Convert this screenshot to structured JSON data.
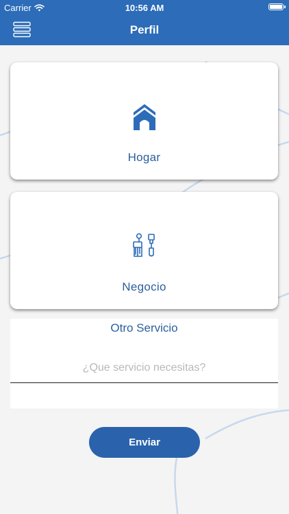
{
  "status_bar": {
    "carrier": "Carrier",
    "time": "10:56 AM",
    "battery_level": 1.0
  },
  "nav_bar": {
    "title": "Perfil",
    "menu_icon": "menu-icon"
  },
  "cards": {
    "hogar": {
      "label": "Hogar",
      "icon": "house-icon"
    },
    "negocio": {
      "label": "Negocio",
      "icon": "paint-tools-icon"
    }
  },
  "other_service": {
    "title": "Otro Servicio",
    "input_value": "",
    "placeholder": "¿Que servicio necesitas?"
  },
  "send_button": {
    "label": "Enviar"
  },
  "colors": {
    "primary": "#2c6cb8",
    "button": "#2a63ac",
    "label_text": "#2a5f9e",
    "background": "#f4f4f4",
    "decor_lines": "#c8d8ec"
  }
}
